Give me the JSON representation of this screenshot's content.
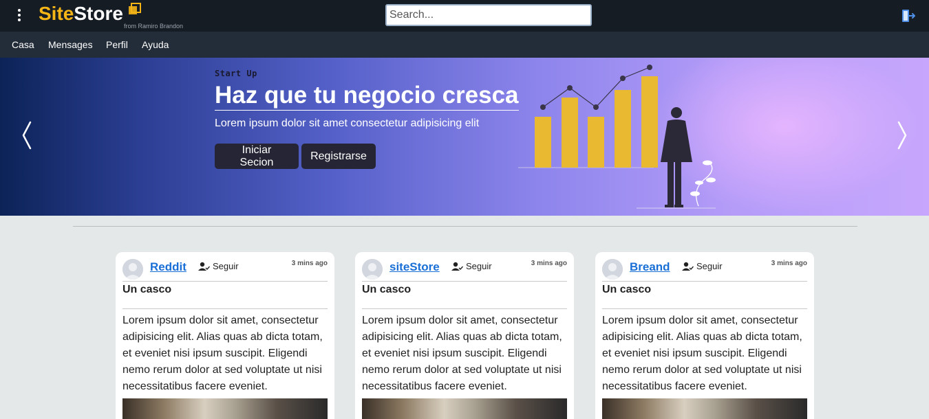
{
  "header": {
    "logo_site": "Site",
    "logo_store": "Store",
    "logo_from": "from Ramiro Brandon",
    "search_placeholder": "Search..."
  },
  "nav": {
    "items": [
      {
        "label": "Casa"
      },
      {
        "label": "Mensages"
      },
      {
        "label": "Perfil"
      },
      {
        "label": "Ayuda"
      }
    ]
  },
  "hero": {
    "eyebrow": "Start Up",
    "title": "Haz que tu negocio cresca",
    "subtitle": "Lorem ipsum dolor sit amet consectetur adipisicing elit",
    "login_label": "Iniciar Secion",
    "register_label": "Registrarse"
  },
  "cards": [
    {
      "author": "Reddit",
      "follow_label": "Seguir",
      "time": "3 mins ago",
      "title": "Un casco",
      "text": "Lorem ipsum dolor sit amet, consectetur adipisicing elit. Alias quas ab dicta totam, et eveniet nisi ipsum suscipit. Eligendi nemo rerum dolor at sed voluptate ut nisi necessitatibus facere eveniet."
    },
    {
      "author": "siteStore",
      "follow_label": "Seguir",
      "time": "3 mins ago",
      "title": "Un casco",
      "text": "Lorem ipsum dolor sit amet, consectetur adipisicing elit. Alias quas ab dicta totam, et eveniet nisi ipsum suscipit. Eligendi nemo rerum dolor at sed voluptate ut nisi necessitatibus facere eveniet."
    },
    {
      "author": "Breand",
      "follow_label": "Seguir",
      "time": "3 mins ago",
      "title": "Un casco",
      "text": "Lorem ipsum dolor sit amet, consectetur adipisicing elit. Alias quas ab dicta totam, et eveniet nisi ipsum suscipit. Eligendi nemo rerum dolor at sed voluptate ut nisi necessitatibus facere eveniet."
    }
  ],
  "colors": {
    "topbar": "#161c24",
    "navbar": "#232d39",
    "brand_yellow": "#f5b517",
    "link_blue": "#1a6fd6",
    "chart_bar": "#e8b931"
  },
  "icons": [
    "kebab-menu-icon",
    "logo-squares-icon",
    "logout-icon",
    "chevron-left-icon",
    "chevron-right-icon",
    "user-check-icon",
    "avatar-icon"
  ]
}
